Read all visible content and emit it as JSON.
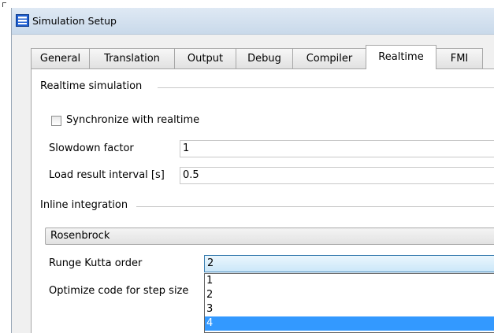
{
  "window": {
    "title": "Simulation Setup"
  },
  "tabs": [
    {
      "label": "General"
    },
    {
      "label": "Translation"
    },
    {
      "label": "Output"
    },
    {
      "label": "Debug"
    },
    {
      "label": "Compiler"
    },
    {
      "label": "Realtime"
    },
    {
      "label": "FMI"
    }
  ],
  "active_tab": "Realtime",
  "realtime_group": {
    "title": "Realtime simulation",
    "synchronize_label": "Synchronize with realtime",
    "synchronize_checked": false,
    "slowdown_label": "Slowdown factor",
    "slowdown_value": "1",
    "load_interval_label": "Load result interval [s]",
    "load_interval_value": "0.5"
  },
  "inline_group": {
    "title": "Inline integration",
    "method_value": "Rosenbrock",
    "rk_order_label": "Runge Kutta order",
    "rk_order_value": "2",
    "optimize_label": "Optimize code for step size",
    "rk_order_options": [
      "1",
      "2",
      "3",
      "4"
    ],
    "rk_order_highlighted": "4"
  },
  "colors": {
    "selection": "#3399ff",
    "titlebar": "#c9d9ea",
    "icon_accent": "#1f5fd1"
  }
}
